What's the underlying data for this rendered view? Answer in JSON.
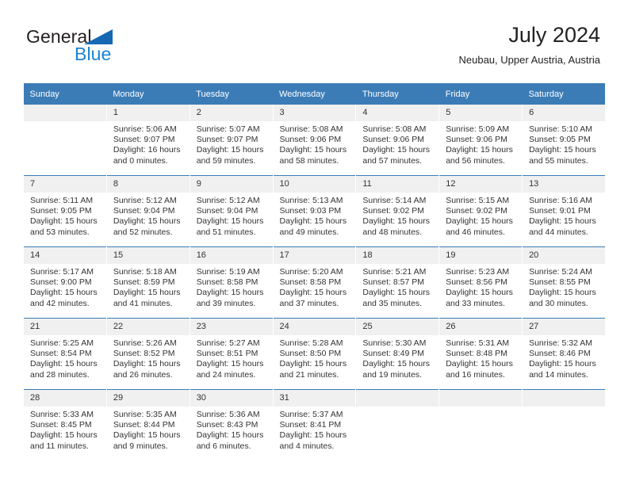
{
  "brand": {
    "name_part1": "General",
    "name_part2": "Blue",
    "triangle_color": "#1668b3",
    "blue_color": "#1b84d4"
  },
  "header": {
    "title": "July 2024",
    "subtitle": "Neubau, Upper Austria, Austria"
  },
  "theme": {
    "header_bar_color": "#3b7cb7",
    "daynum_band_color": "#f0f0f0",
    "text_color": "#333333"
  },
  "weekdays": [
    "Sunday",
    "Monday",
    "Tuesday",
    "Wednesday",
    "Thursday",
    "Friday",
    "Saturday"
  ],
  "weeks": [
    [
      {
        "day": "",
        "sunrise": "",
        "sunset": "",
        "daylight_line1": "",
        "daylight_line2": "",
        "empty": true
      },
      {
        "day": "1",
        "sunrise": "Sunrise: 5:06 AM",
        "sunset": "Sunset: 9:07 PM",
        "daylight_line1": "Daylight: 16 hours",
        "daylight_line2": "and 0 minutes."
      },
      {
        "day": "2",
        "sunrise": "Sunrise: 5:07 AM",
        "sunset": "Sunset: 9:07 PM",
        "daylight_line1": "Daylight: 15 hours",
        "daylight_line2": "and 59 minutes."
      },
      {
        "day": "3",
        "sunrise": "Sunrise: 5:08 AM",
        "sunset": "Sunset: 9:06 PM",
        "daylight_line1": "Daylight: 15 hours",
        "daylight_line2": "and 58 minutes."
      },
      {
        "day": "4",
        "sunrise": "Sunrise: 5:08 AM",
        "sunset": "Sunset: 9:06 PM",
        "daylight_line1": "Daylight: 15 hours",
        "daylight_line2": "and 57 minutes."
      },
      {
        "day": "5",
        "sunrise": "Sunrise: 5:09 AM",
        "sunset": "Sunset: 9:06 PM",
        "daylight_line1": "Daylight: 15 hours",
        "daylight_line2": "and 56 minutes."
      },
      {
        "day": "6",
        "sunrise": "Sunrise: 5:10 AM",
        "sunset": "Sunset: 9:05 PM",
        "daylight_line1": "Daylight: 15 hours",
        "daylight_line2": "and 55 minutes."
      }
    ],
    [
      {
        "day": "7",
        "sunrise": "Sunrise: 5:11 AM",
        "sunset": "Sunset: 9:05 PM",
        "daylight_line1": "Daylight: 15 hours",
        "daylight_line2": "and 53 minutes."
      },
      {
        "day": "8",
        "sunrise": "Sunrise: 5:12 AM",
        "sunset": "Sunset: 9:04 PM",
        "daylight_line1": "Daylight: 15 hours",
        "daylight_line2": "and 52 minutes."
      },
      {
        "day": "9",
        "sunrise": "Sunrise: 5:12 AM",
        "sunset": "Sunset: 9:04 PM",
        "daylight_line1": "Daylight: 15 hours",
        "daylight_line2": "and 51 minutes."
      },
      {
        "day": "10",
        "sunrise": "Sunrise: 5:13 AM",
        "sunset": "Sunset: 9:03 PM",
        "daylight_line1": "Daylight: 15 hours",
        "daylight_line2": "and 49 minutes."
      },
      {
        "day": "11",
        "sunrise": "Sunrise: 5:14 AM",
        "sunset": "Sunset: 9:02 PM",
        "daylight_line1": "Daylight: 15 hours",
        "daylight_line2": "and 48 minutes."
      },
      {
        "day": "12",
        "sunrise": "Sunrise: 5:15 AM",
        "sunset": "Sunset: 9:02 PM",
        "daylight_line1": "Daylight: 15 hours",
        "daylight_line2": "and 46 minutes."
      },
      {
        "day": "13",
        "sunrise": "Sunrise: 5:16 AM",
        "sunset": "Sunset: 9:01 PM",
        "daylight_line1": "Daylight: 15 hours",
        "daylight_line2": "and 44 minutes."
      }
    ],
    [
      {
        "day": "14",
        "sunrise": "Sunrise: 5:17 AM",
        "sunset": "Sunset: 9:00 PM",
        "daylight_line1": "Daylight: 15 hours",
        "daylight_line2": "and 42 minutes."
      },
      {
        "day": "15",
        "sunrise": "Sunrise: 5:18 AM",
        "sunset": "Sunset: 8:59 PM",
        "daylight_line1": "Daylight: 15 hours",
        "daylight_line2": "and 41 minutes."
      },
      {
        "day": "16",
        "sunrise": "Sunrise: 5:19 AM",
        "sunset": "Sunset: 8:58 PM",
        "daylight_line1": "Daylight: 15 hours",
        "daylight_line2": "and 39 minutes."
      },
      {
        "day": "17",
        "sunrise": "Sunrise: 5:20 AM",
        "sunset": "Sunset: 8:58 PM",
        "daylight_line1": "Daylight: 15 hours",
        "daylight_line2": "and 37 minutes."
      },
      {
        "day": "18",
        "sunrise": "Sunrise: 5:21 AM",
        "sunset": "Sunset: 8:57 PM",
        "daylight_line1": "Daylight: 15 hours",
        "daylight_line2": "and 35 minutes."
      },
      {
        "day": "19",
        "sunrise": "Sunrise: 5:23 AM",
        "sunset": "Sunset: 8:56 PM",
        "daylight_line1": "Daylight: 15 hours",
        "daylight_line2": "and 33 minutes."
      },
      {
        "day": "20",
        "sunrise": "Sunrise: 5:24 AM",
        "sunset": "Sunset: 8:55 PM",
        "daylight_line1": "Daylight: 15 hours",
        "daylight_line2": "and 30 minutes."
      }
    ],
    [
      {
        "day": "21",
        "sunrise": "Sunrise: 5:25 AM",
        "sunset": "Sunset: 8:54 PM",
        "daylight_line1": "Daylight: 15 hours",
        "daylight_line2": "and 28 minutes."
      },
      {
        "day": "22",
        "sunrise": "Sunrise: 5:26 AM",
        "sunset": "Sunset: 8:52 PM",
        "daylight_line1": "Daylight: 15 hours",
        "daylight_line2": "and 26 minutes."
      },
      {
        "day": "23",
        "sunrise": "Sunrise: 5:27 AM",
        "sunset": "Sunset: 8:51 PM",
        "daylight_line1": "Daylight: 15 hours",
        "daylight_line2": "and 24 minutes."
      },
      {
        "day": "24",
        "sunrise": "Sunrise: 5:28 AM",
        "sunset": "Sunset: 8:50 PM",
        "daylight_line1": "Daylight: 15 hours",
        "daylight_line2": "and 21 minutes."
      },
      {
        "day": "25",
        "sunrise": "Sunrise: 5:30 AM",
        "sunset": "Sunset: 8:49 PM",
        "daylight_line1": "Daylight: 15 hours",
        "daylight_line2": "and 19 minutes."
      },
      {
        "day": "26",
        "sunrise": "Sunrise: 5:31 AM",
        "sunset": "Sunset: 8:48 PM",
        "daylight_line1": "Daylight: 15 hours",
        "daylight_line2": "and 16 minutes."
      },
      {
        "day": "27",
        "sunrise": "Sunrise: 5:32 AM",
        "sunset": "Sunset: 8:46 PM",
        "daylight_line1": "Daylight: 15 hours",
        "daylight_line2": "and 14 minutes."
      }
    ],
    [
      {
        "day": "28",
        "sunrise": "Sunrise: 5:33 AM",
        "sunset": "Sunset: 8:45 PM",
        "daylight_line1": "Daylight: 15 hours",
        "daylight_line2": "and 11 minutes."
      },
      {
        "day": "29",
        "sunrise": "Sunrise: 5:35 AM",
        "sunset": "Sunset: 8:44 PM",
        "daylight_line1": "Daylight: 15 hours",
        "daylight_line2": "and 9 minutes."
      },
      {
        "day": "30",
        "sunrise": "Sunrise: 5:36 AM",
        "sunset": "Sunset: 8:43 PM",
        "daylight_line1": "Daylight: 15 hours",
        "daylight_line2": "and 6 minutes."
      },
      {
        "day": "31",
        "sunrise": "Sunrise: 5:37 AM",
        "sunset": "Sunset: 8:41 PM",
        "daylight_line1": "Daylight: 15 hours",
        "daylight_line2": "and 4 minutes."
      },
      {
        "day": "",
        "sunrise": "",
        "sunset": "",
        "daylight_line1": "",
        "daylight_line2": "",
        "empty": true
      },
      {
        "day": "",
        "sunrise": "",
        "sunset": "",
        "daylight_line1": "",
        "daylight_line2": "",
        "empty": true
      },
      {
        "day": "",
        "sunrise": "",
        "sunset": "",
        "daylight_line1": "",
        "daylight_line2": "",
        "empty": true
      }
    ]
  ]
}
